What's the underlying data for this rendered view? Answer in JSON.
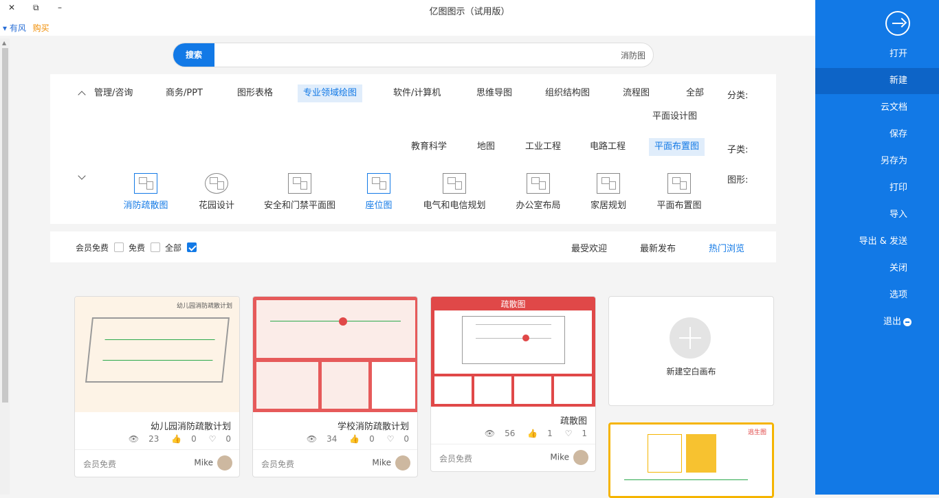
{
  "window": {
    "title": "亿图图示（试用版）",
    "close_glyph": "✕",
    "restore_glyph": "⧉",
    "minimize_glyph": "–"
  },
  "menu": {
    "style_label": "▾ 有风",
    "buy_label": "购买"
  },
  "sidebar": {
    "items": [
      {
        "label": "打开"
      },
      {
        "label": "新建"
      },
      {
        "label": "云文档"
      },
      {
        "label": "保存"
      },
      {
        "label": "另存为"
      },
      {
        "label": "打印"
      },
      {
        "label": "导入"
      },
      {
        "label": "导出 & 发送"
      },
      {
        "label": "关闭"
      },
      {
        "label": "选项"
      },
      {
        "label": "退出"
      }
    ],
    "active_index": 1,
    "color": "#1279e6"
  },
  "search": {
    "button_label": "搜索",
    "value": "消防图"
  },
  "filters": {
    "category_label": "分类:",
    "categories": [
      "全部",
      "流程图",
      "组织结构图",
      "思维导图",
      "软件/计算机",
      "专业领域绘图",
      "图形表格",
      "商务/PPT",
      "管理/咨询",
      "平面设计图"
    ],
    "category_selected": "专业领域绘图",
    "subtype_label": "子类:",
    "subtypes": [
      "平面布置图",
      "电路工程",
      "工业工程",
      "地图",
      "教育科学"
    ],
    "subtype_selected": "平面布置图",
    "shape_label": "图形:",
    "shapes": [
      "平面布置图",
      "家居规划",
      "办公室布局",
      "电气和电信规划",
      "座位图",
      "安全和门禁平面图",
      "花园设计",
      "消防疏散图"
    ],
    "shapes_selected": [
      "座位图",
      "消防疏散图"
    ]
  },
  "sort": {
    "tabs": [
      "热门浏览",
      "最新发布",
      "最受欢迎"
    ],
    "selected": "热门浏览",
    "checks": [
      {
        "label": "全部",
        "checked": true
      },
      {
        "label": "免费",
        "checked": false
      },
      {
        "label": "会员免费",
        "checked": false
      }
    ]
  },
  "cards": {
    "new_blank": "新建空白画布",
    "items": [
      {
        "title": "疏散图",
        "views": "56",
        "likes": "1",
        "favs": "1",
        "author": "Mike",
        "tag": "会员免费",
        "header": "疏散图"
      },
      {
        "title": "学校消防疏散计划",
        "views": "34",
        "likes": "0",
        "favs": "0",
        "author": "Mike",
        "tag": "会员免费"
      },
      {
        "title": "幼儿园消防疏散计划",
        "views": "23",
        "likes": "0",
        "favs": "0",
        "author": "Mike",
        "tag": "会员免费",
        "header": "幼儿园消防疏散计划"
      },
      {
        "header": "逃生图"
      }
    ]
  }
}
